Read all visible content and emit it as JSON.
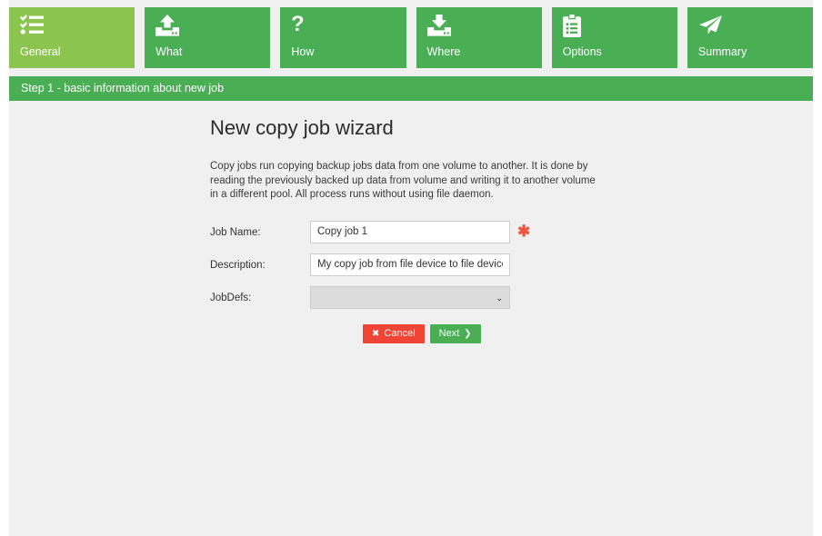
{
  "wizard": {
    "tabs": [
      {
        "label": "General",
        "icon": "checklist-icon",
        "active": true
      },
      {
        "label": "What",
        "icon": "upload-icon",
        "active": false
      },
      {
        "label": "How",
        "icon": "question-icon",
        "active": false
      },
      {
        "label": "Where",
        "icon": "download-icon",
        "active": false
      },
      {
        "label": "Options",
        "icon": "clipboard-list-icon",
        "active": false
      },
      {
        "label": "Summary",
        "icon": "paper-plane-icon",
        "active": false
      }
    ],
    "step_banner": "Step 1 - basic information about new job",
    "title": "New copy job wizard",
    "description": "Copy jobs run copying backup jobs data from one volume to another. It is done by reading the previously backed up data from volume and writing it to another volume in a different pool. All process runs without using file daemon.",
    "fields": {
      "job_name": {
        "label": "Job Name:",
        "value": "Copy job 1",
        "placeholder": "",
        "required_marker": "✱"
      },
      "description": {
        "label": "Description:",
        "value": "My copy job from file device to file device",
        "placeholder": ""
      },
      "jobdefs": {
        "label": "JobDefs:",
        "value": "",
        "options": [
          ""
        ],
        "chevron": "⌄"
      }
    },
    "buttons": {
      "cancel": {
        "label": "Cancel",
        "glyph": "✖"
      },
      "next": {
        "label": "Next",
        "glyph": "❯"
      }
    }
  },
  "colors": {
    "tab_active": "#8cc450",
    "tab_inactive": "#4aae54",
    "banner": "#4aae54",
    "cancel": "#f04434",
    "next": "#4aae54",
    "required": "#f0543f",
    "panel_bg": "#f0f0f0"
  }
}
